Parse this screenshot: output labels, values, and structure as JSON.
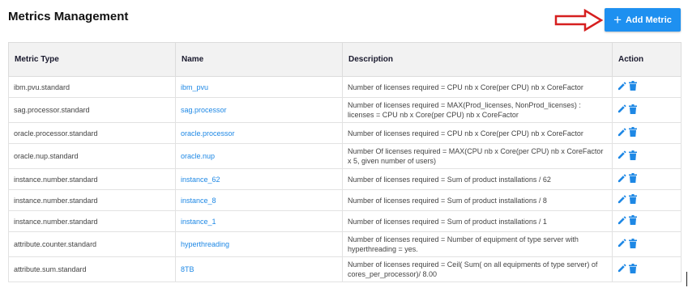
{
  "header": {
    "title": "Metrics Management",
    "add_button_label": "Add Metric"
  },
  "table": {
    "columns": {
      "metric_type": "Metric Type",
      "name": "Name",
      "description": "Description",
      "action": "Action"
    },
    "rows": [
      {
        "metric_type": "ibm.pvu.standard",
        "name": "ibm_pvu",
        "description": "Number of licenses required = CPU nb x Core(per CPU) nb x CoreFactor"
      },
      {
        "metric_type": "sag.processor.standard",
        "name": "sag.processor",
        "description": "Number of licenses required = MAX(Prod_licenses, NonProd_licenses) : licenses = CPU nb x Core(per CPU) nb x CoreFactor"
      },
      {
        "metric_type": "oracle.processor.standard",
        "name": "oracle.processor",
        "description": "Number of licenses required = CPU nb x Core(per CPU) nb x CoreFactor"
      },
      {
        "metric_type": "oracle.nup.standard",
        "name": "oracle.nup",
        "description": "Number Of licenses required = MAX(CPU nb x Core(per CPU) nb x CoreFactor x 5, given number of users)"
      },
      {
        "metric_type": "instance.number.standard",
        "name": "instance_62",
        "description": "Number of licenses required = Sum of product installations / 62"
      },
      {
        "metric_type": "instance.number.standard",
        "name": "instance_8",
        "description": "Number of licenses required = Sum of product installations / 8"
      },
      {
        "metric_type": "instance.number.standard",
        "name": "instance_1",
        "description": "Number of licenses required = Sum of product installations / 1"
      },
      {
        "metric_type": "attribute.counter.standard",
        "name": "hyperthreading",
        "description": "Number of licenses required = Number of equipment of type server with hyperthreading = yes."
      },
      {
        "metric_type": "attribute.sum.standard",
        "name": "8TB",
        "description": "Number of licenses required = Ceil( Sum( on all equipments of type server) of cores_per_processor)/ 8.00"
      }
    ]
  },
  "colors": {
    "accent": "#1e90f0",
    "link": "#1e88e5",
    "arrow": "#d61f1f"
  },
  "icons": {
    "add": "plus-icon",
    "edit": "pencil-icon",
    "delete": "trash-icon",
    "annotation": "red-arrow-icon"
  }
}
